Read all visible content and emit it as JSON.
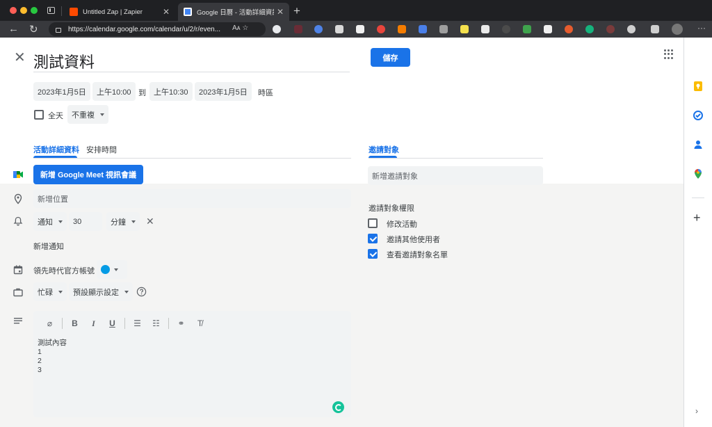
{
  "browser": {
    "tabs": [
      {
        "title": "Untitled Zap | Zapier",
        "favicon_color": "#ff4a00"
      },
      {
        "title": "Google 日曆 - 活動詳細資訊",
        "favicon_color": "#4285f4"
      }
    ],
    "address": "https://calendar.google.com/calendar/u/2/r/even...",
    "address_icons": "Aᴀ ☆"
  },
  "event": {
    "title": "測試資料",
    "save_label": "儲存",
    "start_date": "2023年1月5日",
    "start_time": "上午10:00",
    "to_label": "到",
    "end_time": "上午10:30",
    "end_date": "2023年1月5日",
    "timezone_label": "時區",
    "all_day_label": "全天",
    "all_day_checked": false,
    "repeat_label": "不重複"
  },
  "tabs": {
    "details": "活動詳細資料",
    "schedule": "安排時間",
    "guests": "邀請對象"
  },
  "details": {
    "meet_button": "新增 Google Meet 視訊會議",
    "location_placeholder": "新增位置",
    "notification_type": "通知",
    "notification_value": "30",
    "notification_unit": "分鐘",
    "add_notification": "新增通知",
    "calendar_name": "領先時代官方帳號",
    "calendar_color": "#039be5",
    "availability": "忙碌",
    "visibility": "預設顯示設定",
    "description_lines": [
      "測試內容",
      "1",
      "2",
      "3"
    ]
  },
  "guests": {
    "input_placeholder": "新增邀請對象",
    "permissions_title": "邀請對象權限",
    "permissions": [
      {
        "label": "修改活動",
        "checked": false
      },
      {
        "label": "邀請其他使用者",
        "checked": true
      },
      {
        "label": "查看邀請對象名單",
        "checked": true
      }
    ]
  },
  "colors": {
    "accent": "#1a73e8",
    "keep": "#fbbc04",
    "tasks": "#1a73e8",
    "contacts": "#1a73e8",
    "maps": "#34a853"
  }
}
